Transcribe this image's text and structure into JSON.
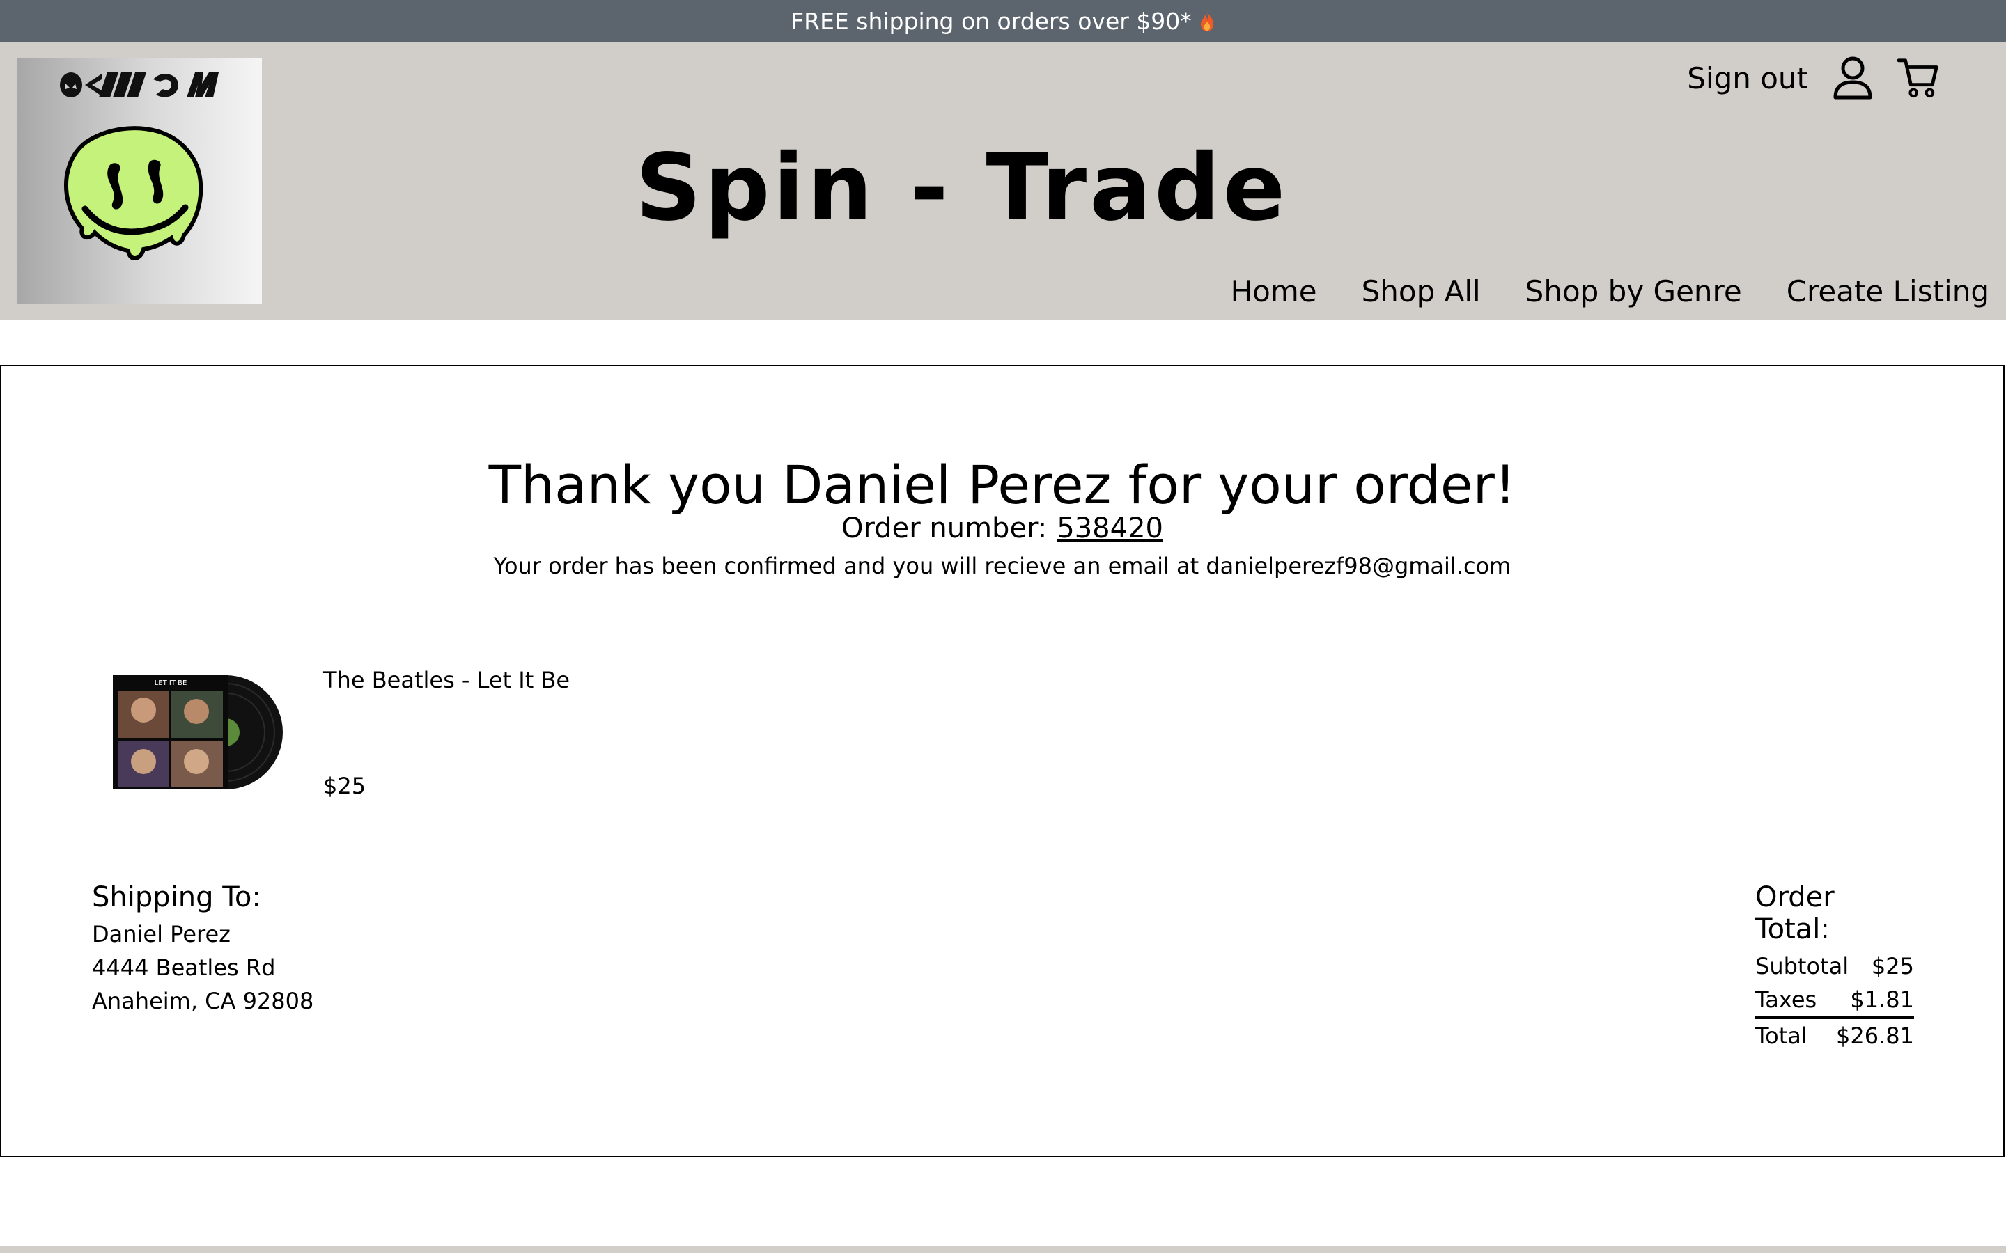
{
  "promo": {
    "text": "FREE shipping on orders over $90*",
    "icon": "flame-icon"
  },
  "logo": {
    "text": "OLLLLOW",
    "icon": "melting-smiley-logo"
  },
  "brand": {
    "title": "Spin - Trade"
  },
  "account": {
    "sign_out": "Sign out",
    "profile_icon": "user-icon",
    "cart_icon": "cart-icon"
  },
  "nav": {
    "items": [
      "Home",
      "Shop All",
      "Shop by Genre",
      "Create Listing"
    ]
  },
  "confirmation": {
    "thanks": "Thank you Daniel Perez for your order!",
    "order_label": "Order number:",
    "order_number": "538420",
    "message": "Your order has been confirmed and you will recieve an email at danielperezf98@gmail.com"
  },
  "item": {
    "title": "The Beatles - Let It Be",
    "price": "$25",
    "image_icon": "vinyl-record-image",
    "cover_text": "LET IT BE"
  },
  "shipping": {
    "heading": "Shipping To:",
    "name": "Daniel Perez",
    "street": "4444 Beatles Rd",
    "city": "Anaheim, CA 92808"
  },
  "totals": {
    "heading": "Order Total:",
    "subtotal_label": "Subtotal",
    "subtotal": "$25",
    "taxes_label": "Taxes",
    "taxes": "$1.81",
    "total_label": "Total",
    "total": "$26.81"
  },
  "colors": {
    "promo_bg": "#5c656e",
    "header_bg": "#d1cec9",
    "logo_green": "#c5f27a"
  }
}
